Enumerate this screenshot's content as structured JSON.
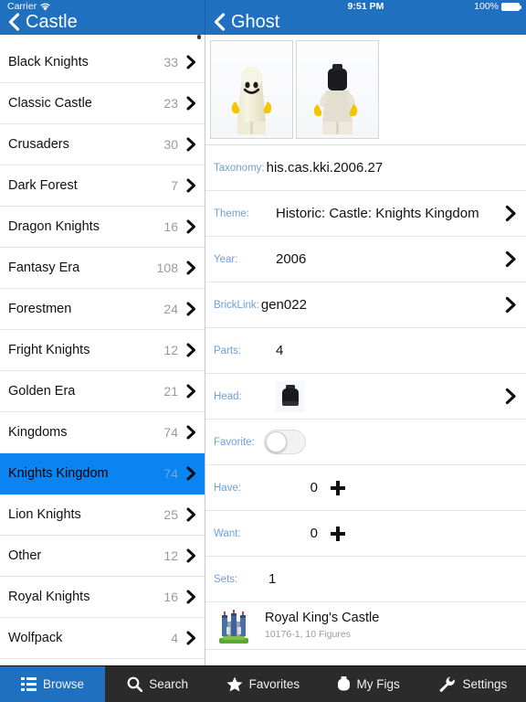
{
  "status": {
    "carrier": "Carrier",
    "wifi_icon": "wifi-icon",
    "time": "9:51 PM",
    "battery": "100%"
  },
  "navbar": {
    "left": {
      "back_icon": "chevron-left-icon",
      "title": "Castle"
    },
    "right": {
      "back_icon": "chevron-left-icon",
      "title": "Ghost"
    }
  },
  "sidebar": {
    "items": [
      {
        "label": "Black Knights",
        "count": "33",
        "selected": false
      },
      {
        "label": "Classic Castle",
        "count": "23",
        "selected": false
      },
      {
        "label": "Crusaders",
        "count": "30",
        "selected": false
      },
      {
        "label": "Dark Forest",
        "count": "7",
        "selected": false
      },
      {
        "label": "Dragon Knights",
        "count": "16",
        "selected": false
      },
      {
        "label": "Fantasy Era",
        "count": "108",
        "selected": false
      },
      {
        "label": "Forestmen",
        "count": "24",
        "selected": false
      },
      {
        "label": "Fright Knights",
        "count": "12",
        "selected": false
      },
      {
        "label": "Golden Era",
        "count": "21",
        "selected": false
      },
      {
        "label": "Kingdoms",
        "count": "74",
        "selected": false
      },
      {
        "label": "Knights Kingdom",
        "count": "74",
        "selected": true
      },
      {
        "label": "Lion Knights",
        "count": "25",
        "selected": false
      },
      {
        "label": "Other",
        "count": "12",
        "selected": false
      },
      {
        "label": "Royal Knights",
        "count": "16",
        "selected": false
      },
      {
        "label": "Wolfpack",
        "count": "4",
        "selected": false
      }
    ]
  },
  "detail": {
    "images": [
      {
        "name": "minifig-front-image",
        "alt": "Ghost minifigure front"
      },
      {
        "name": "minifig-back-image",
        "alt": "Ghost minifigure without shroud"
      }
    ],
    "rows": [
      {
        "label": "Taxonomy:",
        "value": "his.cas.kki.2006.27",
        "chevron": false,
        "indent": false
      },
      {
        "label": "Theme:",
        "value": "Historic: Castle: Knights Kingdom",
        "chevron": true,
        "indent": true
      },
      {
        "label": "Year:",
        "value": "2006",
        "chevron": true,
        "indent": true
      },
      {
        "label": "BrickLink:",
        "value": "gen022",
        "chevron": true,
        "indent": false
      },
      {
        "label": "Parts:",
        "value": "4",
        "chevron": false,
        "indent": true
      },
      {
        "label": "Head:",
        "value": "",
        "chevron": true,
        "indent": true
      }
    ],
    "favorite": {
      "label": "Favorite:",
      "value": "off"
    },
    "have": {
      "label": "Have:",
      "count": "0",
      "add_icon": "plus-icon"
    },
    "want": {
      "label": "Want:",
      "count": "0",
      "add_icon": "plus-icon"
    },
    "sets": {
      "label": "Sets:",
      "count": "1"
    },
    "set_items": [
      {
        "title": "Royal King's Castle",
        "subtitle": "10176-1, 10 Figures"
      }
    ]
  },
  "tabbar": {
    "tabs": [
      {
        "label": "Browse",
        "icon": "list-icon",
        "active": true
      },
      {
        "label": "Search",
        "icon": "magnifier-icon",
        "active": false
      },
      {
        "label": "Favorites",
        "icon": "star-icon",
        "active": false
      },
      {
        "label": "My Figs",
        "icon": "minifig-icon",
        "active": false
      },
      {
        "label": "Settings",
        "icon": "wrench-icon",
        "active": false
      }
    ]
  },
  "colors": {
    "nav_blue": "#2070c0",
    "selected_blue": "#0a84f0",
    "label_blue": "#6d9ede",
    "tab_dark": "#2b2b2b"
  }
}
